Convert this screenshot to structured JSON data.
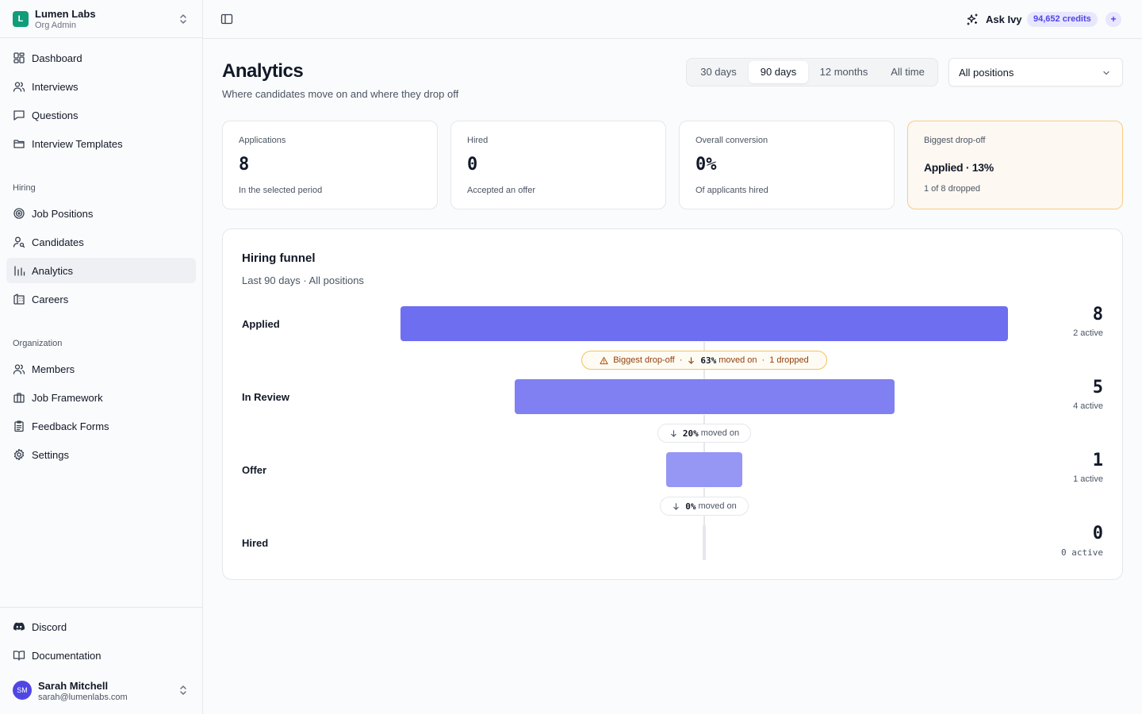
{
  "org": {
    "initial": "L",
    "name": "Lumen Labs",
    "role": "Org Admin"
  },
  "nav": {
    "main": [
      {
        "label": "Dashboard",
        "icon": "dashboard-icon"
      },
      {
        "label": "Interviews",
        "icon": "users-icon"
      },
      {
        "label": "Questions",
        "icon": "message-icon"
      },
      {
        "label": "Interview Templates",
        "icon": "folder-icon"
      }
    ],
    "hiring_title": "Hiring",
    "hiring": [
      {
        "label": "Job Positions",
        "icon": "target-icon"
      },
      {
        "label": "Candidates",
        "icon": "user-search-icon"
      },
      {
        "label": "Analytics",
        "icon": "bar-chart-icon",
        "active": true
      },
      {
        "label": "Careers",
        "icon": "building-icon"
      }
    ],
    "org_title": "Organization",
    "organization": [
      {
        "label": "Members",
        "icon": "users-icon"
      },
      {
        "label": "Job Framework",
        "icon": "briefcase-icon"
      },
      {
        "label": "Feedback Forms",
        "icon": "clipboard-icon"
      },
      {
        "label": "Settings",
        "icon": "gear-icon"
      }
    ],
    "footer": [
      {
        "label": "Discord",
        "icon": "discord-icon"
      },
      {
        "label": "Documentation",
        "icon": "book-icon"
      }
    ]
  },
  "user": {
    "initials": "SM",
    "name": "Sarah Mitchell",
    "email": "sarah@lumenlabs.com"
  },
  "topbar": {
    "ask_label": "Ask Ivy",
    "credits": "94,652 credits",
    "plus": "+"
  },
  "header": {
    "title": "Analytics",
    "subtitle": "Where candidates move on and where they drop off",
    "ranges": [
      "30 days",
      "90 days",
      "12 months",
      "All time"
    ],
    "selected_range": "90 days",
    "position_filter": "All positions"
  },
  "stats": [
    {
      "label": "Applications",
      "value": "8",
      "note": "In the selected period"
    },
    {
      "label": "Hired",
      "value": "0",
      "note": "Accepted an offer"
    },
    {
      "label": "Overall conversion",
      "value": "0%",
      "note": "Of applicants hired"
    }
  ],
  "dropoff": {
    "label": "Biggest drop-off",
    "stage": "Applied",
    "sep": "·",
    "pct": "13%",
    "note": "1 of 8 dropped"
  },
  "funnel": {
    "title": "Hiring funnel",
    "subtitle": "Last 90 days · All positions",
    "colors": {
      "applied": "#6e6ef0",
      "review": "#8080f2",
      "offer": "#9696f5",
      "hired": "#e5e7eb",
      "warn": "#f59e0b"
    },
    "stages": [
      {
        "label": "Applied",
        "count": 8,
        "count_text": "8",
        "active": "2 active"
      },
      {
        "label": "In Review",
        "count": 5,
        "count_text": "5",
        "active": "4 active"
      },
      {
        "label": "Offer",
        "count": 1,
        "count_text": "1",
        "active": "1 active"
      },
      {
        "label": "Hired",
        "count": 0,
        "count_text": "0",
        "active": "0 active"
      }
    ],
    "transitions": [
      {
        "warn_label": "Biggest drop-off",
        "dot": "·",
        "pct": "63%",
        "text": "moved on",
        "dropped": "1 dropped"
      },
      {
        "pct": "20%",
        "text": "moved on"
      },
      {
        "pct": "0%",
        "text": "moved on"
      }
    ]
  }
}
